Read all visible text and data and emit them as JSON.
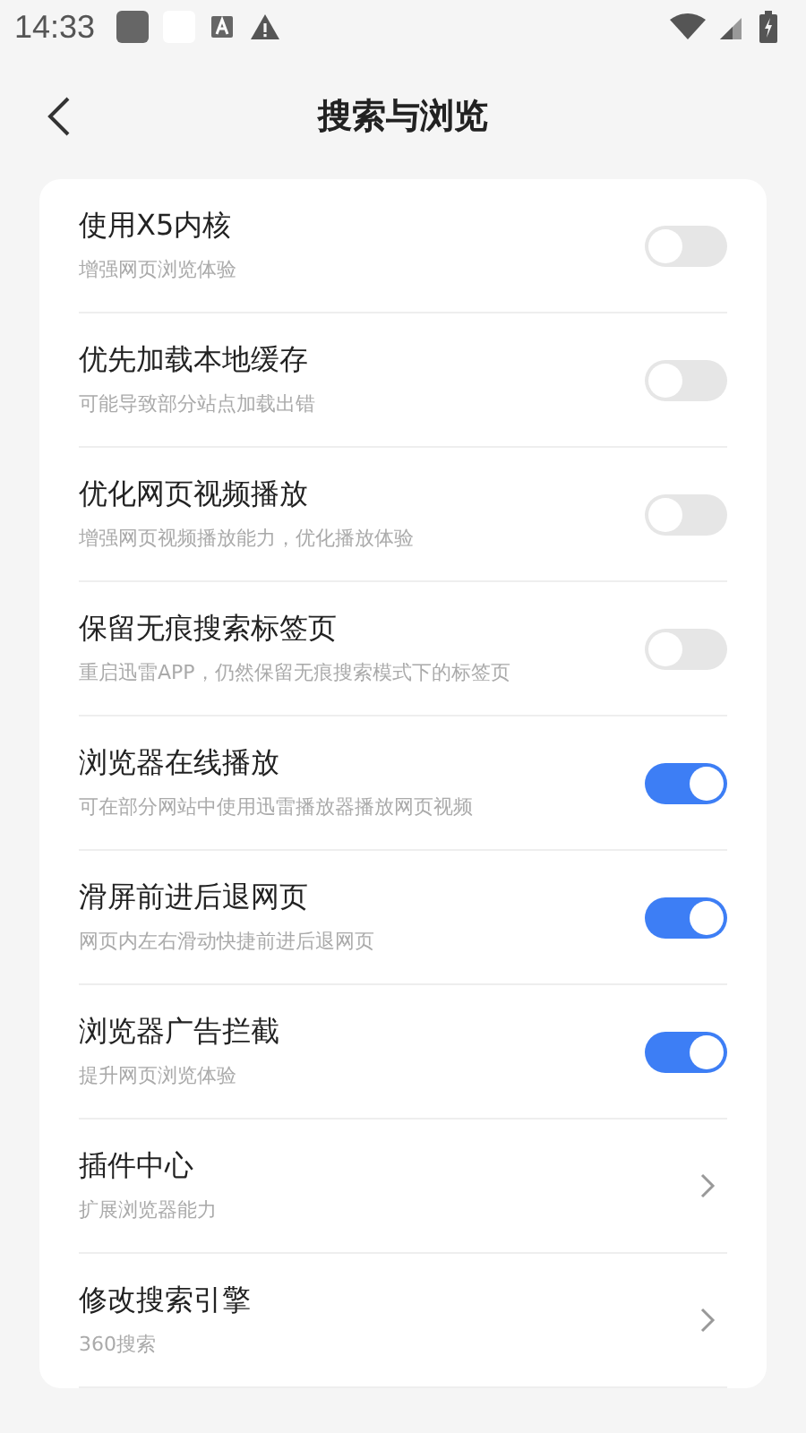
{
  "status_bar": {
    "time": "14:33"
  },
  "header": {
    "title": "搜索与浏览"
  },
  "settings": [
    {
      "kind": "toggle",
      "title": "使用X5内核",
      "subtitle": "增强网页浏览体验",
      "on": false
    },
    {
      "kind": "toggle",
      "title": "优先加载本地缓存",
      "subtitle": "可能导致部分站点加载出错",
      "on": false
    },
    {
      "kind": "toggle",
      "title": "优化网页视频播放",
      "subtitle": "增强网页视频播放能力，优化播放体验",
      "on": false
    },
    {
      "kind": "toggle",
      "title": "保留无痕搜索标签页",
      "subtitle": "重启迅雷APP，仍然保留无痕搜索模式下的标签页",
      "on": false
    },
    {
      "kind": "toggle",
      "title": "浏览器在线播放",
      "subtitle": "可在部分网站中使用迅雷播放器播放网页视频",
      "on": true
    },
    {
      "kind": "toggle",
      "title": "滑屏前进后退网页",
      "subtitle": "网页内左右滑动快捷前进后退网页",
      "on": true
    },
    {
      "kind": "toggle",
      "title": "浏览器广告拦截",
      "subtitle": "提升网页浏览体验",
      "on": true
    },
    {
      "kind": "link",
      "title": "插件中心",
      "subtitle": "扩展浏览器能力"
    },
    {
      "kind": "link",
      "title": "修改搜索引擎",
      "subtitle": "360搜索"
    }
  ]
}
